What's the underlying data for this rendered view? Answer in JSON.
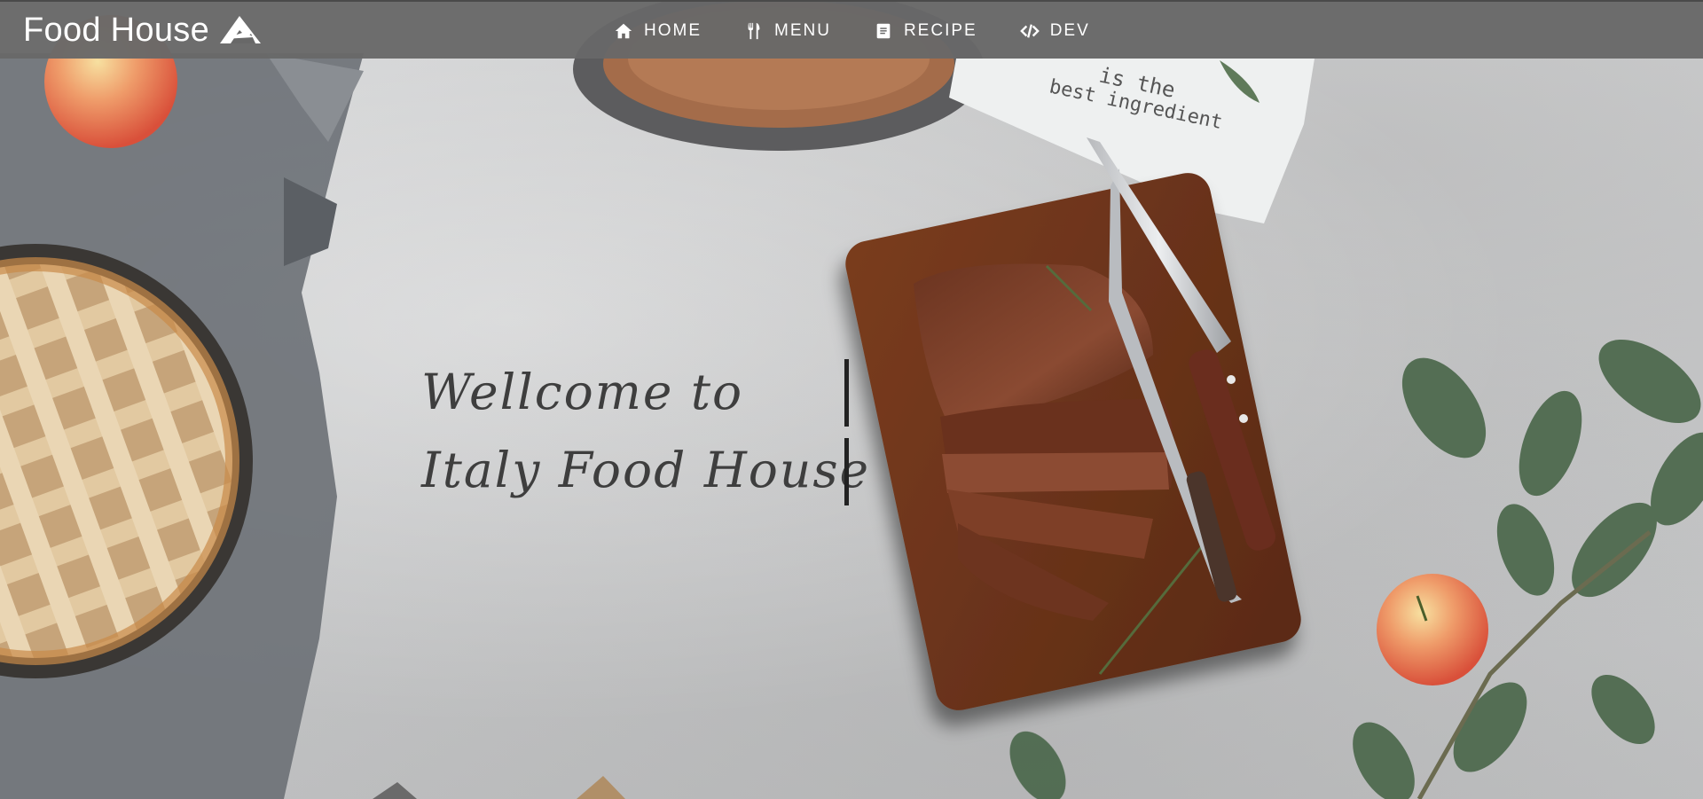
{
  "navbar": {
    "brand": "Food House",
    "logo_icon": "mountain-logo-icon",
    "links": [
      {
        "label": "HOME",
        "icon": "home-icon"
      },
      {
        "label": "MENU",
        "icon": "utensils-icon"
      },
      {
        "label": "RECIPE",
        "icon": "recipe-book-icon"
      },
      {
        "label": "DEV",
        "icon": "code-icon"
      }
    ]
  },
  "hero": {
    "line1": "Wellcome to",
    "line2": "Italy Food House",
    "napkin_text_line1": "is the",
    "napkin_text_line2": "best ingredient"
  },
  "colors": {
    "navbar_bg": "#686868",
    "heading_text": "#3e3e3e",
    "cursor_bar": "#222222"
  }
}
